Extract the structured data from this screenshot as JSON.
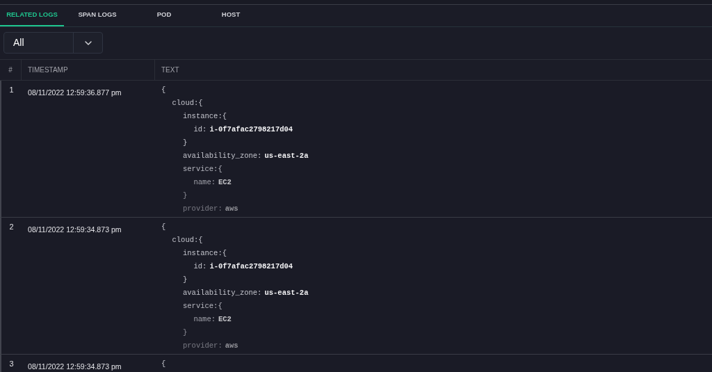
{
  "tabs": [
    {
      "label": "RELATED LOGS",
      "selected": true
    },
    {
      "label": "SPAN LOGS",
      "selected": false
    },
    {
      "label": "POD",
      "selected": false
    },
    {
      "label": "HOST",
      "selected": false
    }
  ],
  "filter": {
    "value": "All"
  },
  "table": {
    "columns": [
      "#",
      "TIMESTAMP",
      "TEXT"
    ],
    "rows": [
      {
        "number": "1",
        "timestamp": "08/11/2022 12:59:36.877 pm",
        "text": {
          "open": "{",
          "children": [
            {
              "key": "cloud:",
              "open": "{",
              "children": [
                {
                  "key": "instance:",
                  "open": "{",
                  "children": [
                    {
                      "key": "id:",
                      "value": "i-0f7afac2798217d04"
                    }
                  ],
                  "close": "}"
                },
                {
                  "key": "availability_zone:",
                  "value": "us-east-2a"
                },
                {
                  "key": "service:",
                  "open": "{",
                  "children": [
                    {
                      "key": "name:",
                      "value": "EC2"
                    }
                  ],
                  "close": "}"
                },
                {
                  "key": "provider:",
                  "value": "aws"
                }
              ]
            }
          ]
        }
      },
      {
        "number": "2",
        "timestamp": "08/11/2022 12:59:34.873 pm",
        "text": {
          "open": "{",
          "children": [
            {
              "key": "cloud:",
              "open": "{",
              "children": [
                {
                  "key": "instance:",
                  "open": "{",
                  "children": [
                    {
                      "key": "id:",
                      "value": "i-0f7afac2798217d04"
                    }
                  ],
                  "close": "}"
                },
                {
                  "key": "availability_zone:",
                  "value": "us-east-2a"
                },
                {
                  "key": "service:",
                  "open": "{",
                  "children": [
                    {
                      "key": "name:",
                      "value": "EC2"
                    }
                  ],
                  "close": "}"
                },
                {
                  "key": "provider:",
                  "value": "aws"
                }
              ]
            }
          ]
        }
      },
      {
        "number": "3",
        "timestamp": "08/11/2022 12:59:34.873 pm",
        "text": {
          "open": "{"
        }
      }
    ]
  }
}
